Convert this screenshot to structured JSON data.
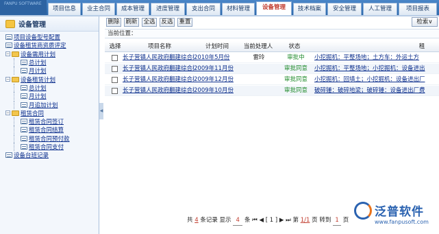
{
  "app": {
    "logo_text": "FANPU SOFTWARE"
  },
  "tabs": [
    {
      "label": "项目信息"
    },
    {
      "label": "业主合同"
    },
    {
      "label": "成本管理"
    },
    {
      "label": "进度管理"
    },
    {
      "label": "支出合同"
    },
    {
      "label": "材料管理"
    },
    {
      "label": "设备管理",
      "active": true
    },
    {
      "label": "技术档案"
    },
    {
      "label": "安全管理"
    },
    {
      "label": "人工管理"
    },
    {
      "label": "项目报表"
    }
  ],
  "sidebar": {
    "title": "设备管理",
    "items": [
      {
        "label": "项目设备型号配置",
        "type": "page",
        "level": 1
      },
      {
        "label": "设备租赁商资质评定",
        "type": "page",
        "level": 1
      },
      {
        "label": "设备需用计划",
        "type": "folder",
        "level": 1
      },
      {
        "label": "总计划",
        "type": "page",
        "level": 2
      },
      {
        "label": "月计划",
        "type": "page",
        "level": 2
      },
      {
        "label": "设备租赁计划",
        "type": "folder",
        "level": 1
      },
      {
        "label": "总计划",
        "type": "page",
        "level": 2
      },
      {
        "label": "月计划",
        "type": "page",
        "level": 2
      },
      {
        "label": "月追加计划",
        "type": "page",
        "level": 2
      },
      {
        "label": "租赁合同",
        "type": "folder",
        "level": 1
      },
      {
        "label": "租赁合同签订",
        "type": "page",
        "level": 2
      },
      {
        "label": "租赁合同结算",
        "type": "page",
        "level": 2
      },
      {
        "label": "租赁合同预付款",
        "type": "page",
        "level": 2
      },
      {
        "label": "租赁合同支付",
        "type": "page",
        "level": 2
      },
      {
        "label": "设备台班记录",
        "type": "page",
        "level": 1
      }
    ]
  },
  "toolbar": {
    "delete": "删除",
    "refresh": "刷新",
    "select_all": "全选",
    "invert": "反选",
    "reset": "重置",
    "search": "检索∨"
  },
  "location": {
    "label": "当前位置："
  },
  "grid": {
    "columns": [
      "选择",
      "项目名称",
      "计划时间",
      "当前处理人",
      "状态",
      "租"
    ],
    "rows": [
      {
        "project": "长子营镇人民政府翻建综合楼",
        "time": "2010年5月份",
        "handler": "雷玲",
        "status": "审批中",
        "detail": "小挖掘机：平整场地；土方车：外运土方"
      },
      {
        "project": "长子营镇人民政府翻建综合楼",
        "time": "2009年11月份",
        "handler": "",
        "status": "审批同意",
        "detail": "小挖掘机：平整场地；小挖掘机：设备进出"
      },
      {
        "project": "长子营镇人民政府翻建综合楼",
        "time": "2009年12月份",
        "handler": "",
        "status": "审批同意",
        "detail": "小挖掘机：回填土；小挖掘机：设备进出厂"
      },
      {
        "project": "长子营镇人民政府翻建综合楼",
        "time": "2009年10月份",
        "handler": "",
        "status": "审批同意",
        "detail": "破碎锤：破碎地梁；破碎锤：设备进出厂费"
      }
    ]
  },
  "pager": {
    "prefix": "共",
    "total": "4",
    "records": "条记录 显示",
    "page_size": "4",
    "per": "条",
    "nav": "⏮ ◀ [ 1 ] ▶ ⏭",
    "page_label": "第",
    "page": "1/1",
    "page_suffix": "页 转到",
    "goto": "1",
    "goto_suffix": "页"
  },
  "brand": {
    "name": "泛普软件",
    "url": "www.fanpusoft.com"
  },
  "colors": {
    "tab_active_text": "#c0392b",
    "link": "#0b2e8c",
    "status_green": "#1e8a2a",
    "brand": "#2a62b0"
  }
}
